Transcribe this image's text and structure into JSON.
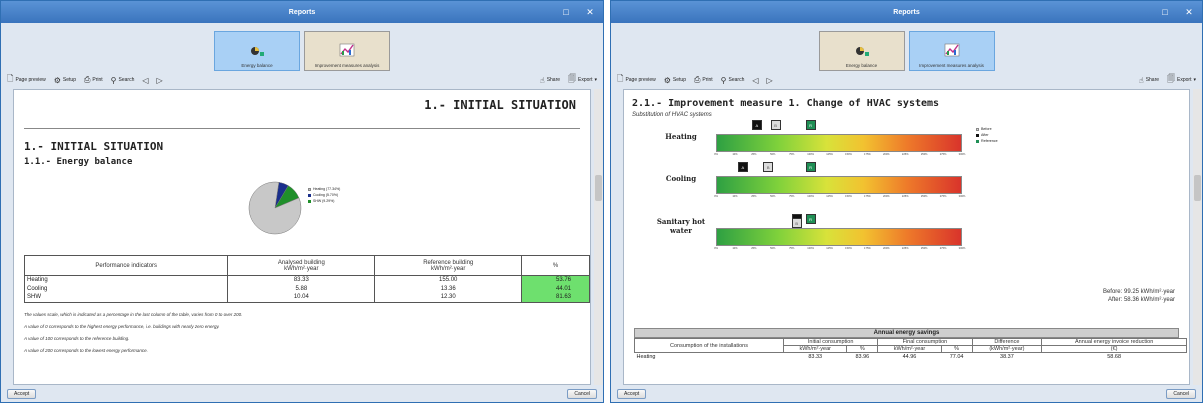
{
  "left": {
    "title": "Reports",
    "tabs": [
      {
        "label": "Energy balance",
        "icon": "energy-balance-icon",
        "active": true
      },
      {
        "label": "Improvement measures analysis",
        "icon": "improvement-chart-icon",
        "active": false
      }
    ],
    "toolbar": {
      "page_preview": "Page preview",
      "setup": "Setup",
      "print": "Print",
      "search": "Search",
      "share": "Share",
      "export": "Export"
    },
    "report": {
      "header_right": "1.- INITIAL SITUATION",
      "heading": "1.- INITIAL SITUATION",
      "subheading": "1.1.- Energy balance",
      "pie_legend": [
        {
          "label": "Heating (77.34%)",
          "color": "#c8c8c8",
          "value": 77.34
        },
        {
          "label": "Cooling (5.70%)",
          "color": "#1a2f8c",
          "value": 5.7
        },
        {
          "label": "SHW (9.29%)",
          "color": "#1f8f2a",
          "value": 9.29
        }
      ],
      "table": {
        "headers": [
          "Performance indicators",
          "Analysed building\nkWh/m²·year",
          "Reference building\nkWh/m²·year",
          "%"
        ],
        "rows": [
          {
            "label": "Heating",
            "analysed": "83.33",
            "reference": "155.00",
            "pct": "53.76"
          },
          {
            "label": "Cooling",
            "analysed": "5.88",
            "reference": "13.36",
            "pct": "44.01"
          },
          {
            "label": "SHW",
            "analysed": "10.04",
            "reference": "12.30",
            "pct": "81.63"
          }
        ]
      },
      "notes": [
        "The values scale, which is indicated as a percentage in the last column of the table, varies from 0 to over 200.",
        "A value of 0 corresponds to the highest energy performance, i.e. buildings with nearly zero energy.",
        "A value of 100 corresponds to the reference building.",
        "A value of 200 corresponds to the lowest energy performance."
      ]
    },
    "buttons": {
      "accept": "Accept",
      "cancel": "Cancel"
    }
  },
  "right": {
    "title": "Reports",
    "tabs": [
      {
        "label": "Energy balance",
        "icon": "energy-balance-icon",
        "active": false
      },
      {
        "label": "Improvement measures analysis",
        "icon": "improvement-chart-icon",
        "active": true
      }
    ],
    "toolbar": {
      "page_preview": "Page preview",
      "setup": "Setup",
      "print": "Print",
      "search": "Search",
      "share": "Share",
      "export": "Export"
    },
    "report": {
      "heading": "2.1.- Improvement measure 1. Change of HVAC systems",
      "subtitle": "Substitution of HVAC systems",
      "legend": [
        {
          "label": "Before",
          "color": "#dcdcdc"
        },
        {
          "label": "After",
          "color": "#111111"
        },
        {
          "label": "Reference",
          "color": "#1f8f55"
        }
      ],
      "scales": [
        {
          "label": "Heating",
          "before_pct": 53.76,
          "after_pct": 28.9,
          "ref_pct": 100
        },
        {
          "label": "Cooling",
          "before_pct": 44.01,
          "after_pct": 16.3,
          "ref_pct": 100
        },
        {
          "label": "Sanitary hot water",
          "before_pct": 81.63,
          "after_pct": 81.63,
          "ref_pct": 100
        }
      ],
      "tick_labels": [
        "0%",
        "10%",
        "25%",
        "50%",
        "75%",
        "100%",
        "125%",
        "150%",
        "175%",
        "200%",
        "225%",
        "250%",
        "275%",
        "300%"
      ],
      "before_text": "Before: 99.25 kWh/m²·year",
      "after_text": "After: 58.36 kWh/m²·year",
      "annual_title": "Annual energy savings",
      "annual_headers": {
        "consumption": "Consumption of the installations",
        "initial": "Initial consumption",
        "final": "Final consumption",
        "difference": "Difference",
        "invoice": "Annual energy invoice reduction",
        "unit_kwh": "kWh/m²·year",
        "unit_pct": "%",
        "unit_diff": "(kWh/m²·year)",
        "unit_eur": "(€)"
      },
      "annual_rows": [
        {
          "label": "Heating",
          "initial_kwh": "83.33",
          "initial_pct": "83.96",
          "final_kwh": "44.96",
          "final_pct": "77.04",
          "diff": "38.37",
          "invoice": "58.68"
        }
      ]
    },
    "buttons": {
      "accept": "Accept",
      "cancel": "Cancel"
    }
  }
}
